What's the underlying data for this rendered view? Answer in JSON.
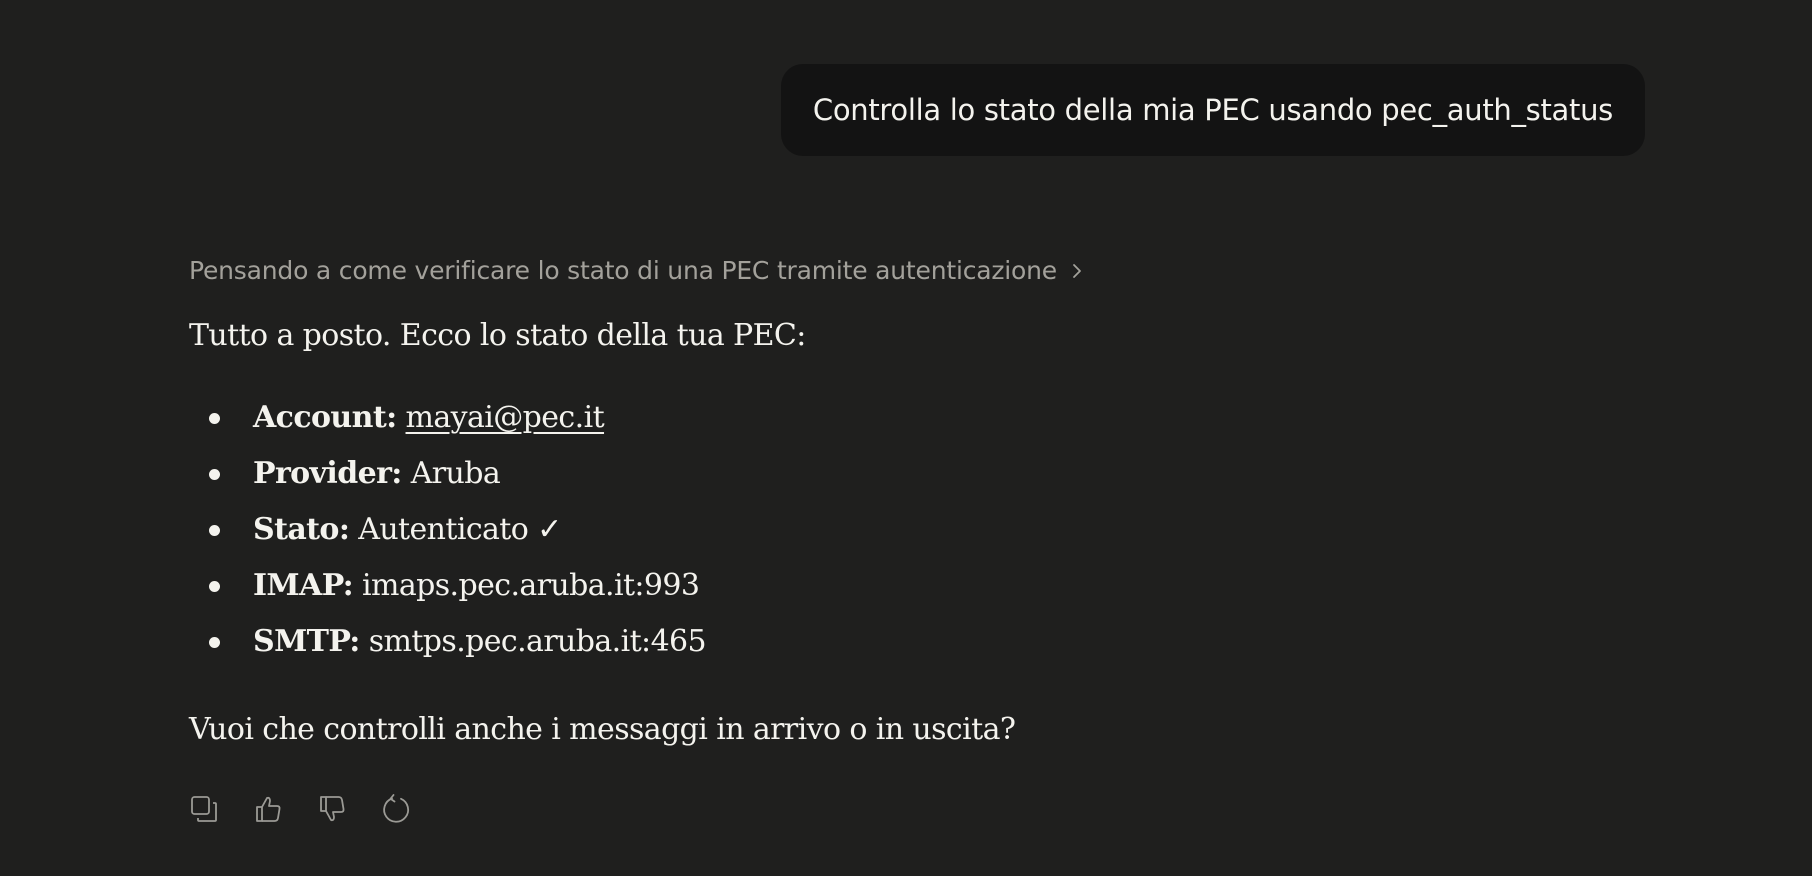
{
  "user_message": "Controlla lo stato della mia PEC usando pec_auth_status",
  "assistant": {
    "thinking_label": "Pensando a come verificare lo stato di una PEC tramite autenticazione",
    "thinking_icon": "chevron-right-icon",
    "intro": "Tutto a posto. Ecco lo stato della tua PEC:",
    "items": [
      {
        "label": "Account:",
        "value": "mayai@pec.it",
        "is_link": true
      },
      {
        "label": "Provider:",
        "value": "Aruba"
      },
      {
        "label": "Stato:",
        "value": "Autenticato ✓"
      },
      {
        "label": "IMAP:",
        "value": "imaps.pec.aruba.it:993"
      },
      {
        "label": "SMTP:",
        "value": "smtps.pec.aruba.it:465"
      }
    ],
    "question": "Vuoi che controlli anche i messaggi in arrivo o in uscita?"
  },
  "actions": [
    {
      "name": "copy",
      "icon": "copy-icon"
    },
    {
      "name": "thumbs-up",
      "icon": "thumbs-up-icon"
    },
    {
      "name": "thumbs-down",
      "icon": "thumbs-down-icon"
    },
    {
      "name": "retry",
      "icon": "retry-icon"
    }
  ],
  "colors": {
    "background": "#1f1f1e",
    "user_bubble": "#131313",
    "text": "#f4f3ee",
    "muted_text": "#a3a19b",
    "icon": "#9b9a95"
  }
}
